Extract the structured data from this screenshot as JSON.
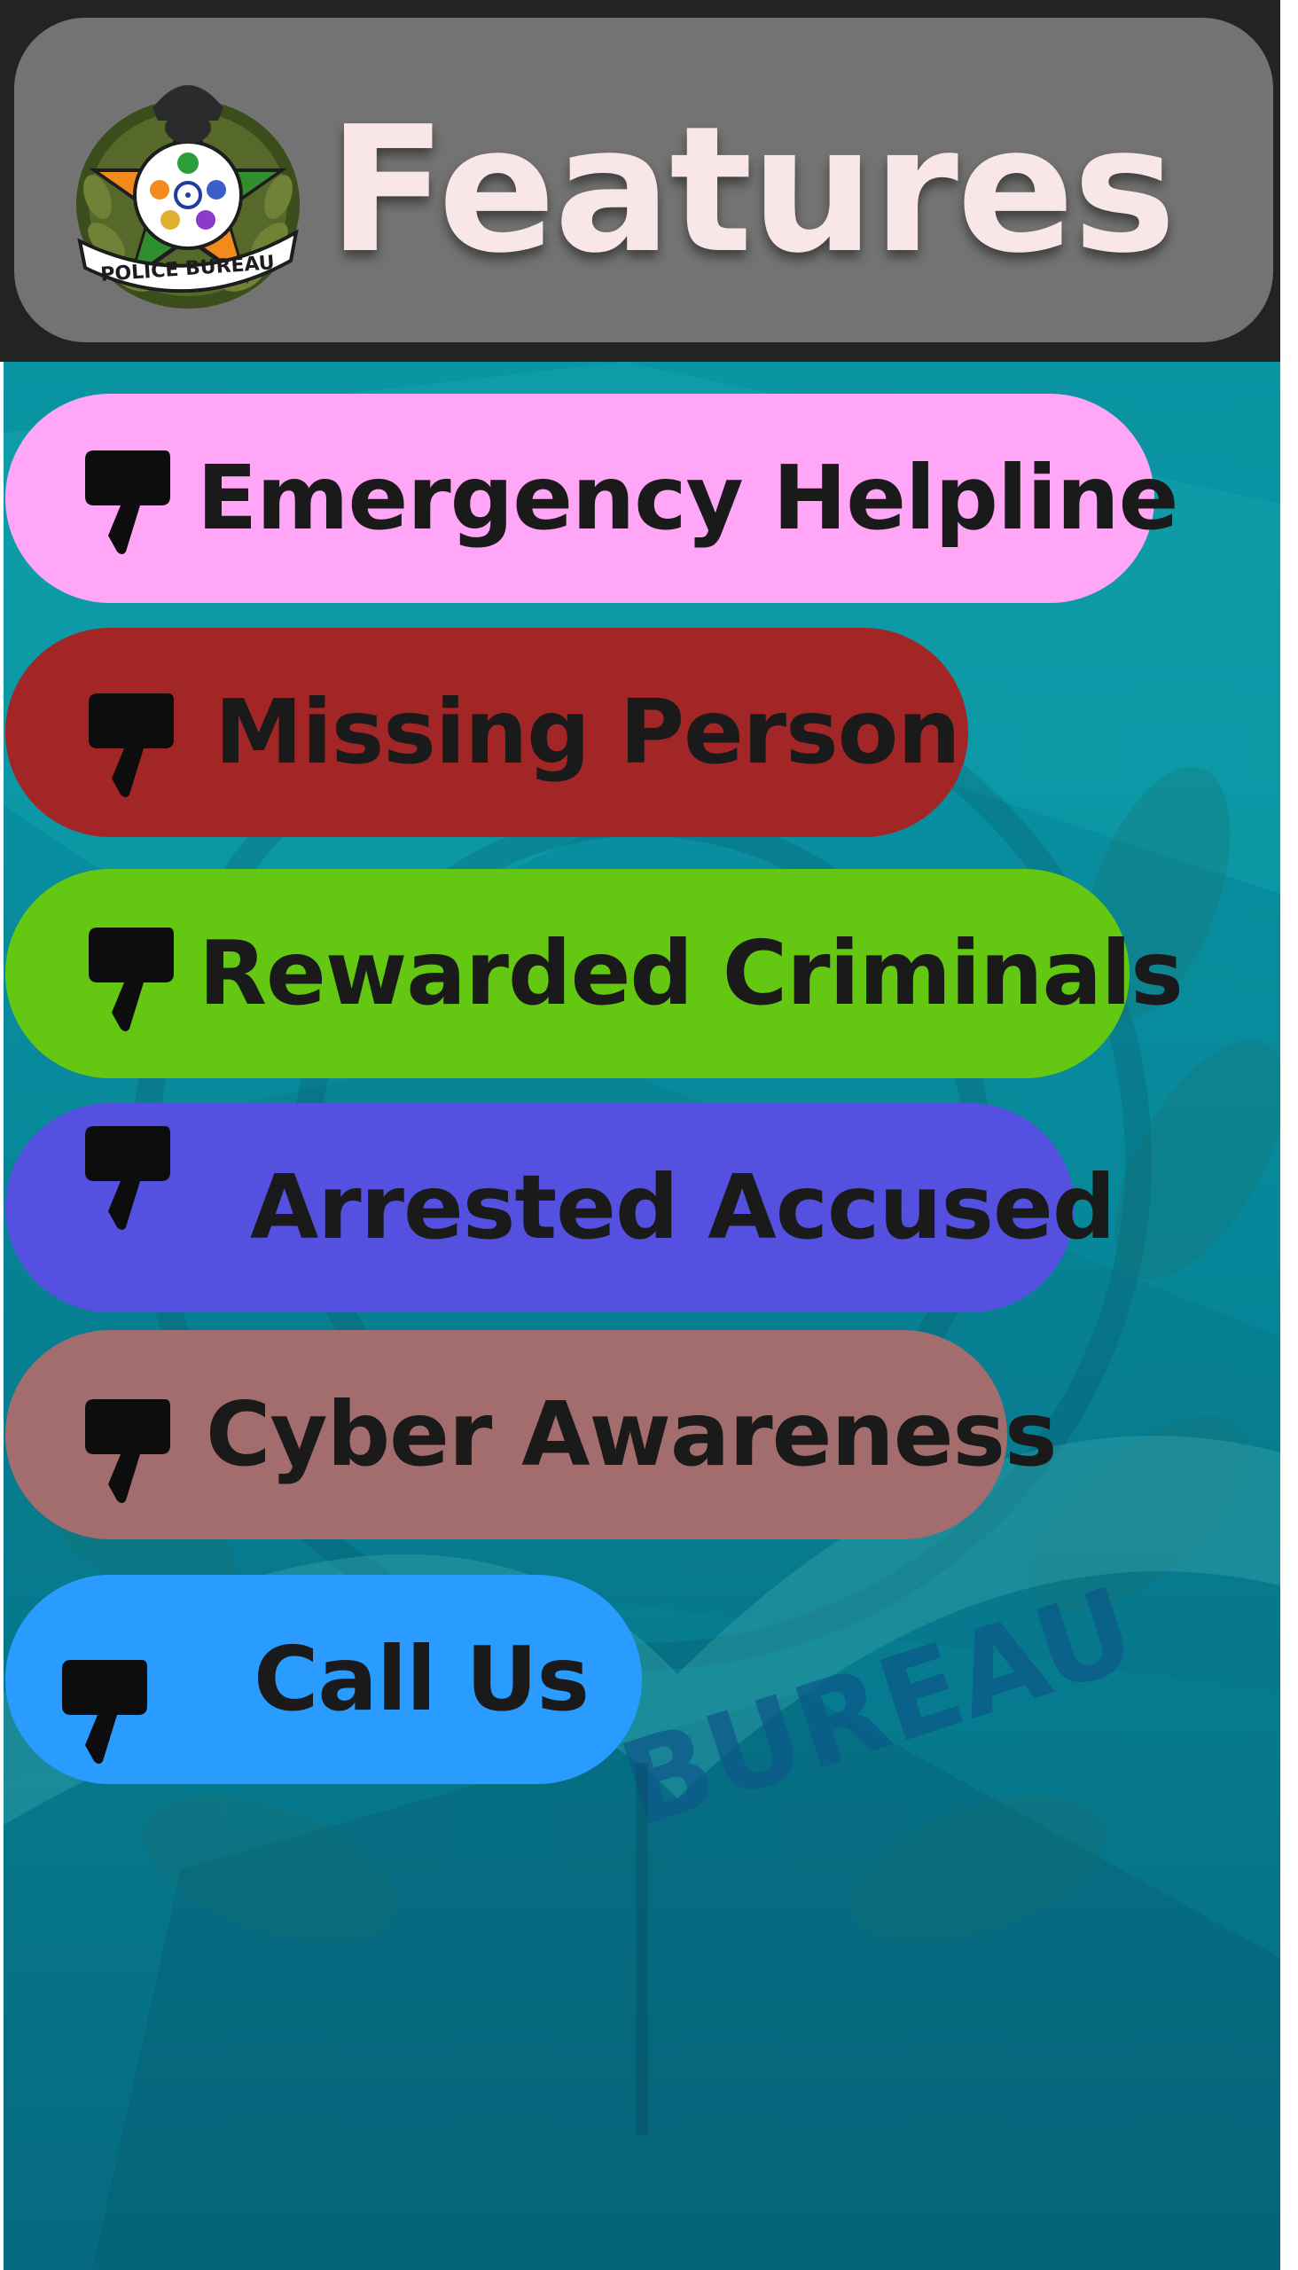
{
  "header": {
    "title": "Features",
    "logo_text": "POLICE BUREAU"
  },
  "menu": [
    {
      "label": "Emergency Helpline",
      "color": "#ffa6f6",
      "icon": "thumbs-down-icon"
    },
    {
      "label": "Missing Person",
      "color": "#a32626",
      "icon": "thumbs-down-icon"
    },
    {
      "label": "Rewarded Criminals",
      "color": "#64c712",
      "icon": "thumbs-down-icon"
    },
    {
      "label": "Arrested Accused",
      "color": "#5551e0",
      "icon": "thumbs-down-icon"
    },
    {
      "label": "Cyber Awareness",
      "color": "#a46d6d",
      "icon": "thumbs-down-icon"
    },
    {
      "label": "Call Us",
      "color": "#2a9bff",
      "icon": "thumbs-down-icon"
    }
  ],
  "background": {
    "watermark_text": "BUREAU"
  },
  "colors": {
    "header_bg": "#232323",
    "header_pill": "#737373",
    "title_color": "#f9e6e6",
    "content_bg": "#0a95a3"
  }
}
